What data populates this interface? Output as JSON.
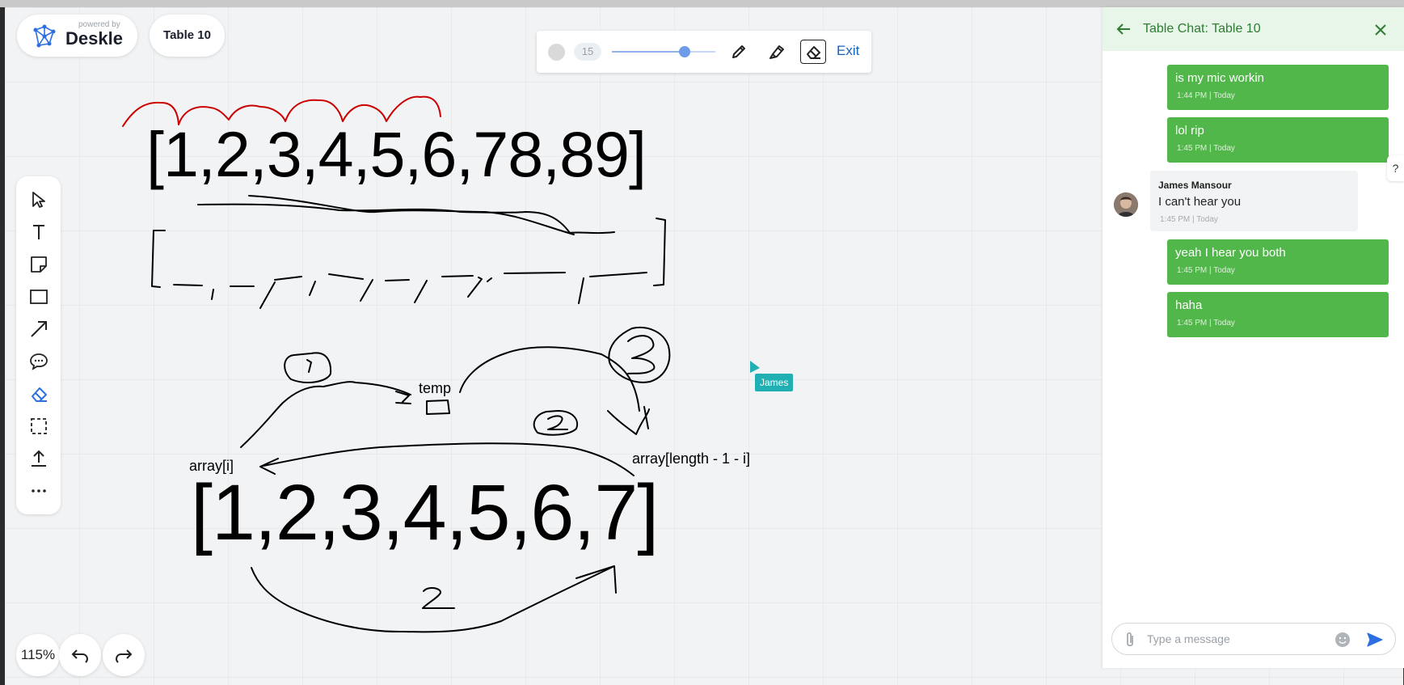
{
  "brand": {
    "powered_by": "powered by",
    "name": "Deskle"
  },
  "table_name": "Table 10",
  "pen_toolbar": {
    "size": "15",
    "size_level": 0.7,
    "exit_label": "Exit"
  },
  "tools": [
    "select",
    "text",
    "sticky-note",
    "rectangle",
    "arrow",
    "comment",
    "eraser",
    "selection",
    "upload",
    "more"
  ],
  "zoom": "115%",
  "canvas": {
    "array_top": "[1,2,3,4,5,6,78,89]",
    "array_bottom": "[1,2,3,4,5,6,7]",
    "label_temp": "temp",
    "label_array_i": "array[i]",
    "label_array_len": "array[length - 1 - i]",
    "cursor_user": "James"
  },
  "chat": {
    "title": "Table Chat: Table 10",
    "messages": [
      {
        "text": "is my mic workin",
        "time": "1:44 PM | Today"
      },
      {
        "text": "lol rip",
        "time": "1:45 PM | Today"
      },
      {
        "author": "James Mansour",
        "text": "I can't hear you",
        "time": "1:45 PM | Today"
      },
      {
        "text": "yeah I hear you both",
        "time": "1:45 PM | Today"
      },
      {
        "text": "haha",
        "time": "1:45 PM | Today"
      }
    ],
    "input_placeholder": "Type a message",
    "help": "?"
  },
  "colors": {
    "accent": "#52b74a",
    "link": "#1565c0",
    "cursor": "#20b0b3",
    "ink": "#000000",
    "red_ink": "#cc0000"
  }
}
